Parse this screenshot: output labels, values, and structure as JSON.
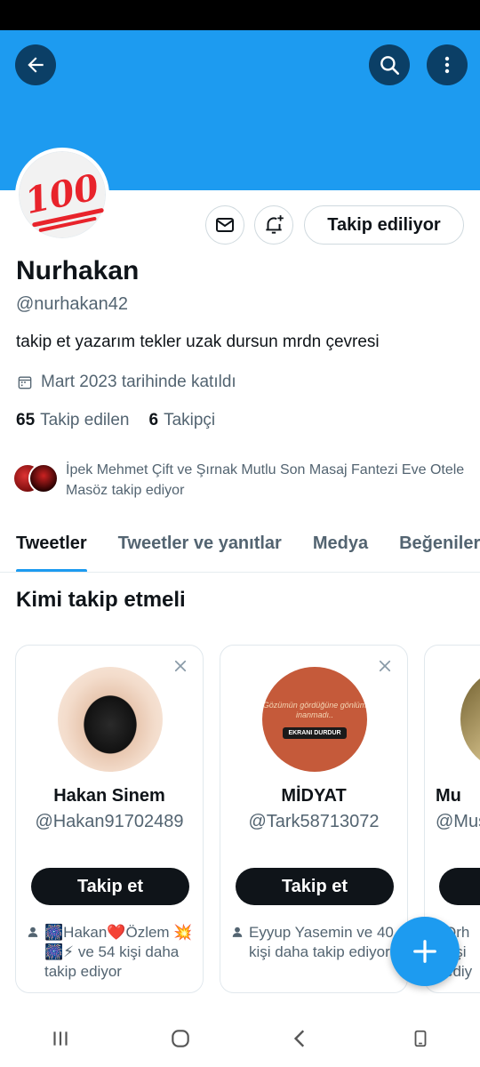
{
  "profile": {
    "display_name": "Nurhakan",
    "handle": "@nurhakan42",
    "bio": "takip et yazarım tekler uzak dursun mrdn çevresi",
    "joined": "Mart 2023 tarihinde katıldı",
    "avatar_emoji": "100",
    "following_count": "65",
    "following_label": "Takip edilen",
    "followers_count": "6",
    "followers_label": "Takipçi",
    "follow_state_label": "Takip ediliyor",
    "followed_by_text": "İpek Mehmet Çift ve Şırnak Mutlu Son Masaj Fantezi Eve Otele Masöz takip ediyor"
  },
  "header": {
    "back_icon": "arrow-left-icon",
    "search_icon": "search-icon",
    "more_icon": "more-vertical-icon"
  },
  "tabs": [
    {
      "label": "Tweetler",
      "active": true
    },
    {
      "label": "Tweetler ve yanıtlar",
      "active": false
    },
    {
      "label": "Medya",
      "active": false
    },
    {
      "label": "Beğeniler",
      "active": false
    }
  ],
  "who_to_follow": {
    "title": "Kimi takip etmeli",
    "cards": [
      {
        "name": "Hakan Sinem",
        "handle": "@Hakan91702489",
        "follow_label": "Takip et",
        "followed_by": "🎆Hakan❤️Özlem 💥🎆⚡ ve 54 kişi daha takip ediyor"
      },
      {
        "name": "MİDYAT",
        "handle": "@Tark58713072",
        "follow_label": "Takip et",
        "followed_by": "Eyyup Yasemin ve 40 kişi daha takip ediyor",
        "avatar_text": "Gözümün gördüğüne gönlüm inanmadı..",
        "avatar_badge": "EKRANI DURDUR"
      },
      {
        "name": "Mu",
        "handle": "@Mus",
        "follow_label": "",
        "followed_by": "Orh kişi ediy"
      }
    ]
  },
  "colors": {
    "brand": "#1d9bf0",
    "dark_button": "#0f1419",
    "secondary_text": "#536471"
  }
}
